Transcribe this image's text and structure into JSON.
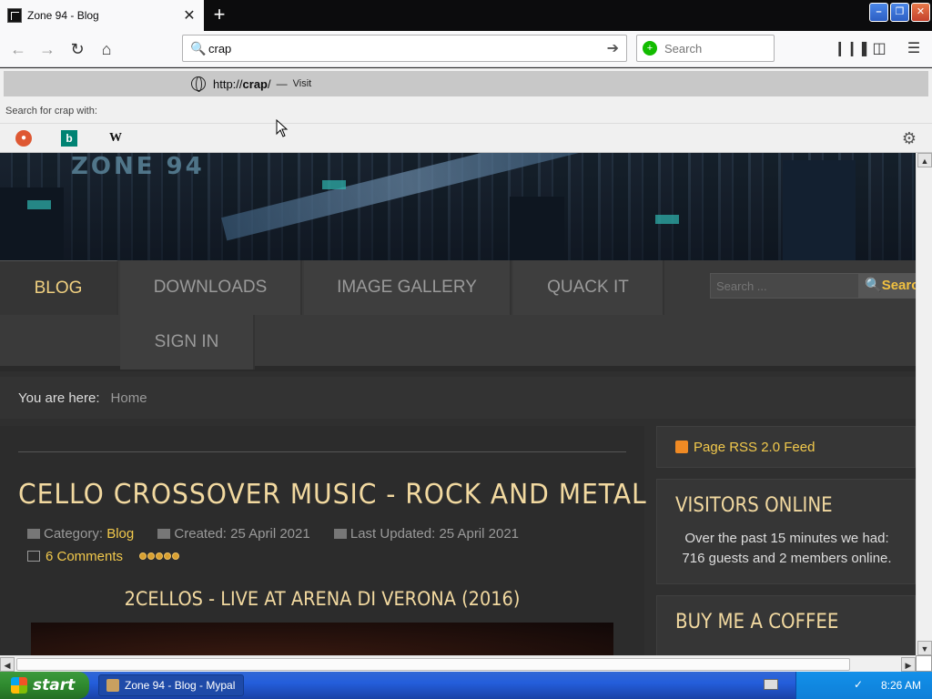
{
  "browser": {
    "tab_title": "Zone 94 - Blog",
    "tab_close": "✕",
    "new_tab": "+",
    "window_buttons": {
      "minimize": "–",
      "restore": "❐",
      "close": "✕"
    },
    "nav": {
      "back": "←",
      "forward": "→",
      "reload": "↻",
      "home": "⌂"
    },
    "url_value": "crap",
    "search_placeholder": "Search"
  },
  "suggestion": {
    "prefix": "http://",
    "bold": "crap",
    "suffix": "/",
    "dash": "—",
    "visit": "Visit",
    "search_for_prefix": "Search for ",
    "search_for_term": "crap",
    "search_for_suffix": " with:",
    "engines": {
      "bing": "b",
      "wikipedia": "W"
    }
  },
  "site": {
    "banner_logo": "ZONE 94",
    "nav": [
      {
        "label": "BLOG",
        "active": true
      },
      {
        "label": "DOWNLOADS"
      },
      {
        "label": "IMAGE GALLERY"
      },
      {
        "label": "QUACK IT"
      },
      {
        "label": "SIGN IN"
      }
    ],
    "search_placeholder": "Search ...",
    "search_button": "Search",
    "breadcrumb_label": "You are here:",
    "breadcrumb_home": "Home"
  },
  "article": {
    "title": "CELLO CROSSOVER MUSIC - ROCK AND METAL",
    "category_label": "Category:",
    "category": "Blog",
    "created": "Created: 25 April 2021",
    "updated": "Last Updated: 25 April 2021",
    "comments": "6 Comments",
    "subtitle": "2CELLOS - LIVE AT ARENA DI VERONA (2016)"
  },
  "sidebar": {
    "rss": "Page RSS 2.0 Feed",
    "visitors_title": "VISITORS ONLINE",
    "visitors_line1": "Over the past 15 minutes we had:",
    "visitors_line2": "716 guests and 2 members online.",
    "coffee_title": "BUY ME A COFFEE"
  },
  "taskbar": {
    "start": "start",
    "task": "Zone 94 - Blog - Mypal",
    "clock": "8:26 AM"
  },
  "colors": {
    "accent": "#f2c94c",
    "heading": "#f2d9a0",
    "start_green": "#3c9a3c"
  }
}
